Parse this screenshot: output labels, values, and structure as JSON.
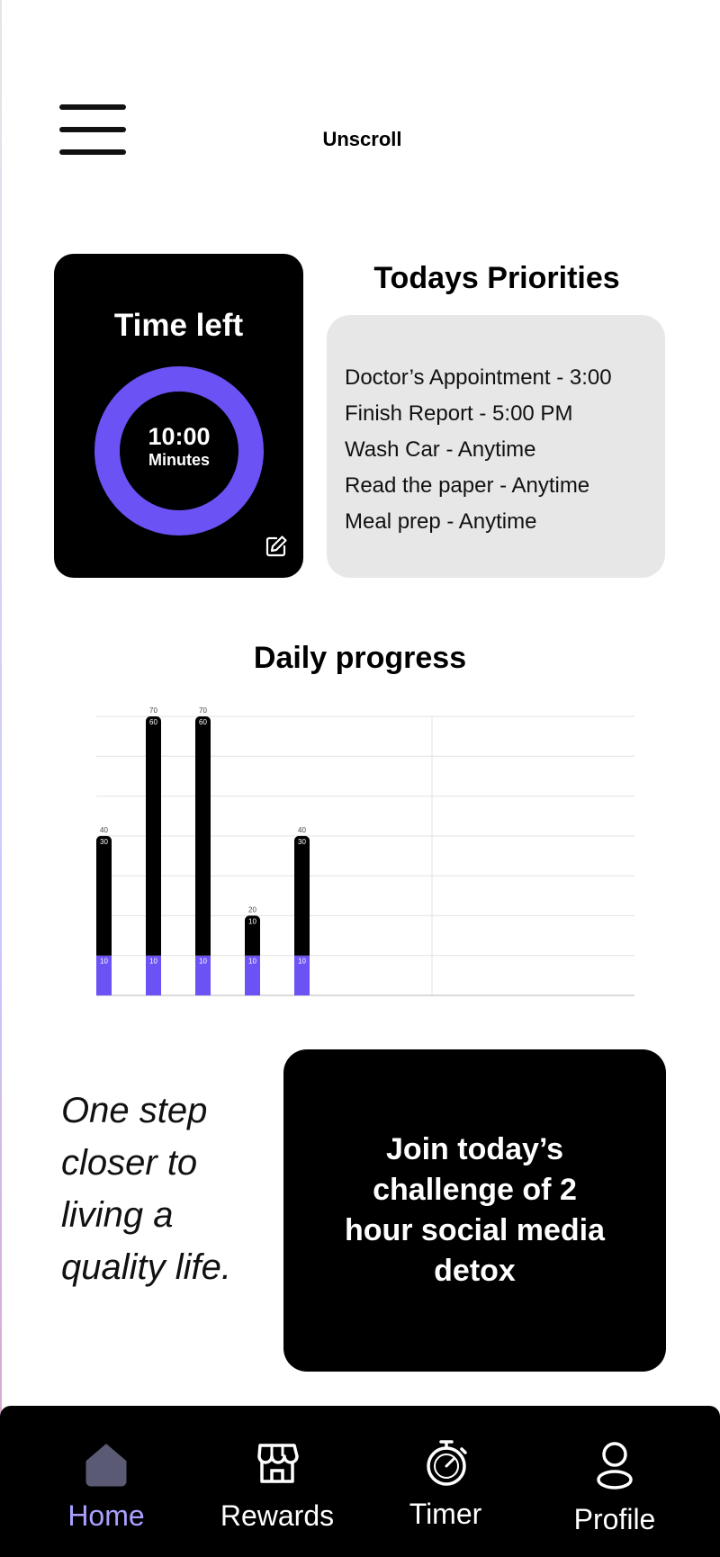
{
  "header": {
    "app_title": "Unscroll"
  },
  "timer_card": {
    "label": "Time left",
    "time": "10:00",
    "unit": "Minutes"
  },
  "priorities": {
    "title": "Todays Priorities",
    "items": [
      "Doctor’s Appointment - 3:00",
      "Finish Report - 5:00 PM",
      "Wash Car - Anytime",
      "Read the paper - Anytime",
      "Meal prep - Anytime"
    ]
  },
  "progress": {
    "title": "Daily progress"
  },
  "chart_data": {
    "type": "bar",
    "stacked": true,
    "categories": [
      "",
      "",
      "",
      "",
      ""
    ],
    "total_labels": [
      "40",
      "70",
      "70",
      "20",
      "40"
    ],
    "series": [
      {
        "values": [
          10,
          10,
          10,
          10,
          10
        ],
        "labels": [
          "10",
          "10",
          "10",
          "10",
          "10"
        ],
        "color": "#6b52f5"
      },
      {
        "values": [
          30,
          60,
          60,
          10,
          30
        ],
        "labels": [
          "30",
          "60",
          "60",
          "10",
          "30"
        ],
        "color": "#000000"
      }
    ],
    "ylim": [
      0,
      70
    ],
    "grid": true
  },
  "quote": {
    "text": "One step closer to living a quality life."
  },
  "challenge": {
    "text": "Join today’s challenge of 2 hour social media detox"
  },
  "nav": {
    "items": [
      {
        "label": "Home",
        "icon": "home-icon",
        "active": true
      },
      {
        "label": "Rewards",
        "icon": "store-icon",
        "active": false
      },
      {
        "label": "Timer",
        "icon": "stopwatch-icon",
        "active": false
      },
      {
        "label": "Profile",
        "icon": "person-icon",
        "active": false
      }
    ]
  },
  "colors": {
    "accent": "#6b52f5",
    "nav_active": "#a9a0ff",
    "card_dark": "#000000",
    "card_light": "#e7e7e7"
  }
}
